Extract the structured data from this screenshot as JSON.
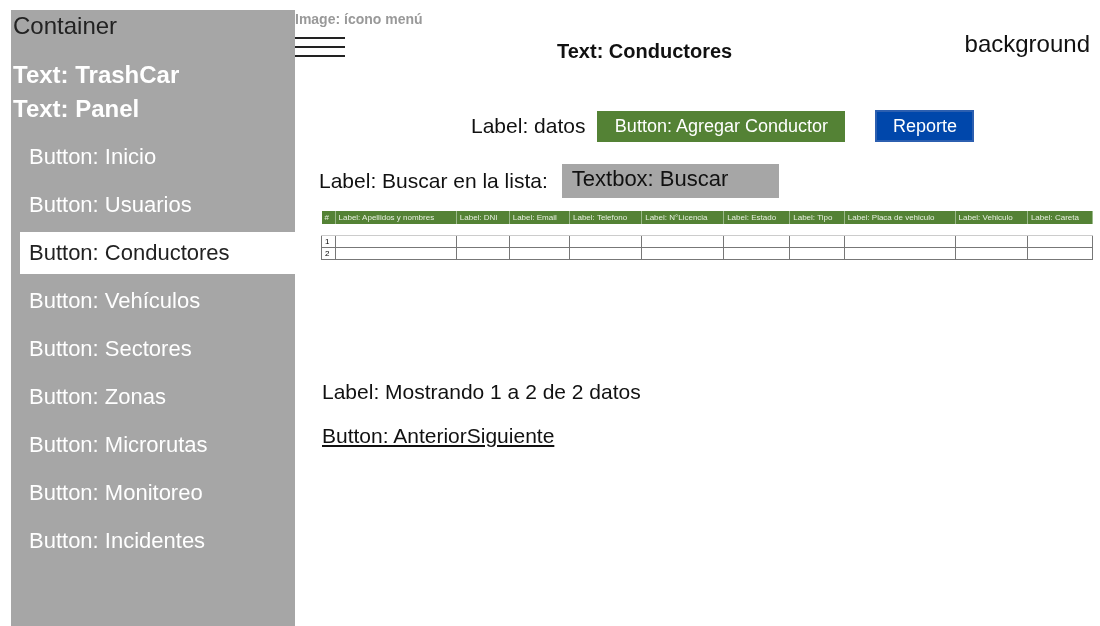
{
  "sidebar": {
    "heading": "Container",
    "title": "Text: TrashCar",
    "subtitle": "Text: Panel",
    "items": [
      {
        "label": "Button: Inicio",
        "selected": false
      },
      {
        "label": "Button: Usuarios",
        "selected": false
      },
      {
        "label": "Button: Conductores",
        "selected": true
      },
      {
        "label": "Button: Vehículos",
        "selected": false
      },
      {
        "label": "Button: Sectores",
        "selected": false
      },
      {
        "label": "Button: Zonas",
        "selected": false
      },
      {
        "label": "Button: Microrutas",
        "selected": false
      },
      {
        "label": "Button: Monitoreo",
        "selected": false
      },
      {
        "label": "Button: Incidentes",
        "selected": false
      }
    ]
  },
  "main": {
    "menu_icon_label": "Image: ícono menú",
    "title": "Text: Conductores",
    "corner_label": "background",
    "data_label": "Label: datos",
    "add_button": "Button: Agregar Conductor",
    "report_button": "Reporte",
    "search_label": "Label: Buscar en la lista:",
    "search_value": "Textbox: Buscar",
    "table": {
      "columns": [
        "#",
        "Label: Apellidos y nombres",
        "Label: DNI",
        "Label: Email",
        "Label: Telefono",
        "Label: N°Licencia",
        "Label: Estado",
        "Label: Tipo",
        "Label: Placa de vehiculo",
        "Label: Vehiculo",
        "Label: Careta"
      ],
      "rows": [
        {
          "number": "1"
        },
        {
          "number": "2"
        }
      ]
    },
    "summary": "Label: Mostrando 1 a 2 de 2 datos",
    "pager": "Button: AnteriorSiguiente"
  }
}
